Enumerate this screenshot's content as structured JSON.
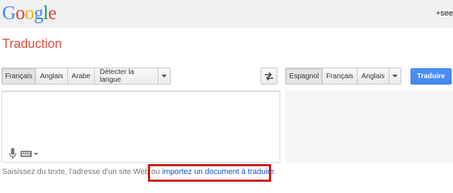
{
  "header": {
    "logo_letters": [
      {
        "ch": "G",
        "color": "#4285f4"
      },
      {
        "ch": "o",
        "color": "#db4437"
      },
      {
        "ch": "o",
        "color": "#f4b400"
      },
      {
        "ch": "g",
        "color": "#4285f4"
      },
      {
        "ch": "l",
        "color": "#0f9d58"
      },
      {
        "ch": "e",
        "color": "#db4437"
      }
    ],
    "user_link": "+see"
  },
  "page_title": "Traduction",
  "source_langs": {
    "items": [
      "Français",
      "Anglais",
      "Arabe",
      "Détecter la langue"
    ],
    "selected_index": 0
  },
  "target_langs": {
    "items": [
      "Espagnol",
      "Français",
      "Anglais"
    ],
    "selected_index": 0
  },
  "translate_label": "Traduire",
  "hint": {
    "prefix": "Saisissez du texte, l'adresse d'un site Web ou ",
    "link": "importez un document à traduire",
    "suffix": "."
  },
  "icons": [
    "microphone-icon",
    "keyboard-icon",
    "swap-arrows-icon",
    "chevron-down-icon"
  ],
  "colors": {
    "accent_red": "#dd4b39",
    "translate_blue": "#4d90fe",
    "link_blue": "#1155cc",
    "highlight_red": "#cc1111"
  }
}
